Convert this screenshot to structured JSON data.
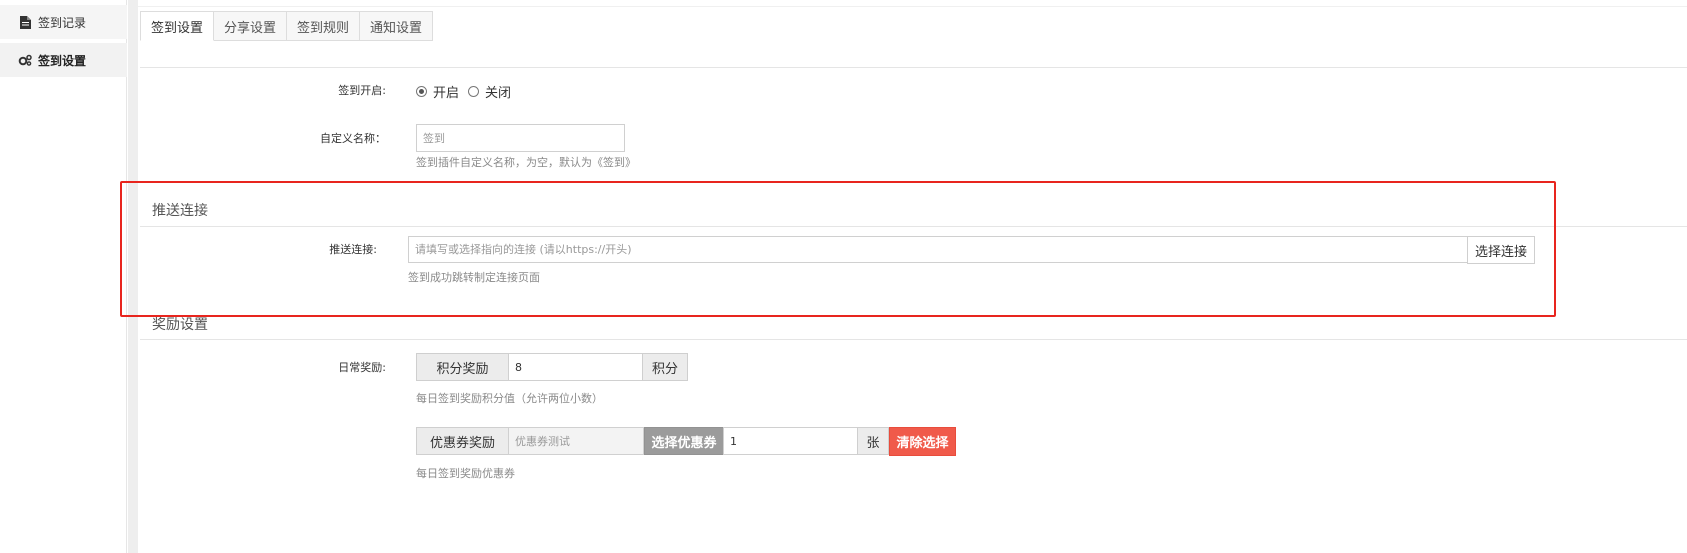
{
  "sidebar": {
    "items": [
      {
        "label": "签到记录",
        "icon": "document-icon"
      },
      {
        "label": "签到设置",
        "icon": "gears-icon"
      }
    ]
  },
  "tabs": [
    "签到设置",
    "分享设置",
    "签到规则",
    "通知设置"
  ],
  "form": {
    "signin_open": {
      "label": "签到开启:",
      "options": [
        "开启",
        "关闭"
      ],
      "selected": "开启"
    },
    "custom_name": {
      "label": "自定义名称：",
      "placeholder": "签到",
      "help": "签到插件自定义名称，为空，默认为《签到》"
    }
  },
  "push": {
    "section_title": "推送连接",
    "label": "推送连接:",
    "placeholder": "请填写或选择指向的连接 (请以https://开头)",
    "select_button": "选择连接",
    "help": "签到成功跳转制定连接页面"
  },
  "reward": {
    "section_title": "奖励设置",
    "daily_label": "日常奖励:",
    "points_addon": "积分奖励",
    "points_value": "8",
    "points_unit": "积分",
    "points_help": "每日签到奖励积分值（允许两位小数）",
    "coupon_addon": "优惠券奖励",
    "coupon_selected": "优惠券测试",
    "coupon_select_button": "选择优惠券",
    "coupon_qty": "1",
    "coupon_unit": "张",
    "coupon_clear_button": "清除选择",
    "coupon_help": "每日签到奖励优惠券"
  },
  "colors": {
    "highlight_border": "#e8251e",
    "clear_button": "#f05a4a",
    "select_coupon_button": "#9b9b9b"
  }
}
